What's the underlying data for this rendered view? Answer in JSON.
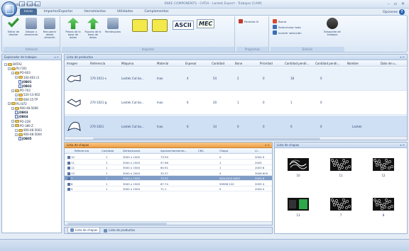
{
  "app": {
    "title": "ENKE COMPONENTS - CATIA - Lantek Expert - Trabajos [CAM]",
    "window_controls": [
      "–",
      "▫",
      "✕"
    ],
    "help_label": "Opciones",
    "help_icon": "?"
  },
  "ribbon": {
    "tabs": [
      "Inicio",
      "Importar/Exportar",
      "Herramientas",
      "Utilidades",
      "Complementos"
    ],
    "active_tab": "Inicio",
    "groups": [
      {
        "label": "Almacén"
      },
      {
        "label": "Importar"
      },
      {
        "label": "Programas"
      },
      {
        "label": "Edición"
      }
    ],
    "buttons": {
      "editar_disenar": "Editar de diseñar",
      "almacenar": "Dibujar y almacenar",
      "recuperar": "Recuperar desde almacén",
      "base_datos": "Piezas de la base de datos",
      "figuras": "Figuras de la base de datos",
      "rectangulos": "Rectángulos",
      "ascii": "ASCII",
      "mec": "MEC",
      "panel": "Pantalla Gr",
      "borrar": "Borrar",
      "seleccionar_todo": "Seleccionar todo",
      "invertir": "Invertir selección",
      "busqueda": "Búsqueda de trabajos"
    }
  },
  "tree": {
    "title": "Explorador de trabajos",
    "items": [
      {
        "label": "DATA2",
        "level": 0,
        "kind": "folder"
      },
      {
        "label": "PLI 501",
        "level": 1,
        "kind": "folder"
      },
      {
        "label": "PO-603",
        "level": 2,
        "kind": "folder"
      },
      {
        "label": "100-403 (3",
        "level": 3,
        "kind": "folder"
      },
      {
        "label": "JOB01",
        "level": 4,
        "kind": "doc",
        "bold": true
      },
      {
        "label": "JOB02",
        "level": 4,
        "kind": "doc",
        "bold": true
      },
      {
        "label": "PO-703",
        "level": 2,
        "kind": "folder"
      },
      {
        "label": "520-13-002",
        "level": 3,
        "kind": "folder"
      },
      {
        "label": "600-15-TP",
        "level": 3,
        "kind": "folder"
      },
      {
        "label": "PLI 872",
        "level": 1,
        "kind": "folder"
      },
      {
        "label": "900-48-5006",
        "level": 2,
        "kind": "folder"
      },
      {
        "label": "JOB03",
        "level": 3,
        "kind": "doc",
        "bold": true
      },
      {
        "label": "JOB04",
        "level": 3,
        "kind": "doc",
        "bold": true
      },
      {
        "label": "PO-228",
        "level": 2,
        "kind": "folder"
      },
      {
        "label": "PO-389 Z",
        "level": 2,
        "kind": "folder"
      },
      {
        "label": "900-48-5003",
        "level": 3,
        "kind": "folder"
      },
      {
        "label": "900-48-5004",
        "level": 3,
        "kind": "folder"
      },
      {
        "label": "JOB05",
        "level": 4,
        "kind": "doc",
        "bold": true
      }
    ]
  },
  "products": {
    "title": "Lista de productos",
    "columns": [
      "Imagen",
      "Referencia",
      "Máquina",
      "Material",
      "Espesor",
      "Cantidad",
      "Bono",
      "Prioridad",
      "Cantidad pendi...",
      "Cantidad pendi...",
      "Nombre",
      "Dato de u..."
    ],
    "rows": [
      {
        "referencia": "170-1011-s",
        "maquina": "Lantek Cut bo...",
        "material": "Inox",
        "espesor": "4",
        "cantidad": "54",
        "bono": "2",
        "prioridad": "0",
        "pend1": "18",
        "pend2": "0",
        "nombre": "",
        "dato": ""
      },
      {
        "referencia": "270-1021-g",
        "maquina": "Lantek Cut bo...",
        "material": "Inox",
        "espesor": "6",
        "cantidad": "20",
        "bono": "1",
        "prioridad": "0",
        "pend1": "1",
        "pend2": "0",
        "nombre": "",
        "dato": ""
      },
      {
        "referencia": "270-1021",
        "maquina": "Lantek Cut bo...",
        "material": "Inox",
        "espesor": "6",
        "cantidad": "14",
        "bono": "0",
        "prioridad": "0",
        "pend1": "0",
        "pend2": "0",
        "nombre": "",
        "dato": "Lantek"
      }
    ]
  },
  "sheets": {
    "title": "Lista de chapas",
    "columns": [
      "Referencia",
      "Cantidad",
      "Dimensiones",
      "Aprovechamiento...",
      "CNC",
      "Chapa",
      "U..."
    ],
    "rows": [
      {
        "ref": "10",
        "cant": "1",
        "dim": "3000 x 1500",
        "aprov": "73.59",
        "cnc": "",
        "chapa": "0",
        "u": "2004 9"
      },
      {
        "ref": "11",
        "cant": "1",
        "dim": "3000 x 1500",
        "aprov": "57.96",
        "cnc": "",
        "chapa": "1",
        "u": "2005"
      },
      {
        "ref": "12",
        "cant": "1",
        "dim": "3000 x 1500",
        "aprov": "60.91",
        "cnc": "",
        "chapa": "1",
        "u": "2003 8"
      },
      {
        "ref": "13",
        "cant": "1",
        "dim": "3000 x 2000",
        "aprov": "35.37",
        "cnc": "",
        "chapa": "0",
        "u": "3008 605"
      },
      {
        "ref": "7",
        "cant": "1",
        "dim": "3000 x 1500",
        "aprov": "75.02",
        "cnc": "",
        "chapa": "NOV2000 6000",
        "u": "2004 6"
      },
      {
        "ref": "8",
        "cant": "1",
        "dim": "3000 x 1500",
        "aprov": "87.74",
        "cnc": "",
        "chapa": "99998 220",
        "u": "2005 4"
      },
      {
        "ref": "9",
        "cant": "1",
        "dim": "3000 x 1500",
        "aprov": "71.1",
        "cnc": "",
        "chapa": "0",
        "u": "2004 0"
      }
    ],
    "selected_index": 4
  },
  "sheet_images": {
    "title": "Lista de chapas",
    "items": [
      {
        "label": "10",
        "style": "swirl"
      },
      {
        "label": "11",
        "style": "dense"
      },
      {
        "label": "12",
        "style": "dense"
      },
      {
        "label": "13",
        "style": "green"
      },
      {
        "label": "7",
        "style": "dense"
      },
      {
        "label": "8",
        "style": "dense"
      }
    ]
  },
  "bottom_tabs": [
    "Lista de chapas",
    "Lista de productos"
  ],
  "status": {
    "text": "Búsqueda de trabajos"
  },
  "colors": {
    "accent": "#4a6d99",
    "orange_header": "#ef9e44",
    "selection": "#7f9cc6",
    "product_selection": "#cfe0f4"
  }
}
